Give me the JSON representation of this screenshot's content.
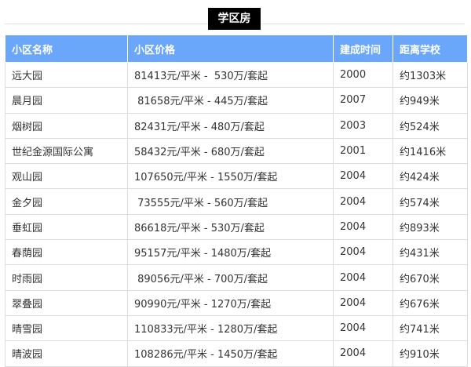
{
  "title": "学区房",
  "table": {
    "headers": [
      "小区名称",
      "小区价格",
      "建成时间",
      "距离学校"
    ],
    "rows": [
      [
        "远大园",
        "81413元/平米 -  530万/套起",
        "2000",
        "约1303米"
      ],
      [
        "晨月园",
        " 81658元/平米 - 445万/套起",
        "2007",
        "约949米"
      ],
      [
        "烟树园",
        "82431元/平米 - 480万/套起",
        "2003",
        "约524米"
      ],
      [
        "世纪金源国际公寓",
        "58432元/平米 - 680万/套起",
        "2001",
        "约1416米"
      ],
      [
        "观山园",
        "107650元/平米 - 1550万/套起",
        "2004",
        "约424米"
      ],
      [
        "金夕园",
        " 73555元/平米 - 560万/套起",
        "2004",
        "约574米"
      ],
      [
        "垂虹园",
        "86618元/平米 - 530万/套起",
        "2004",
        "约893米"
      ],
      [
        "春荫园",
        "95157元/平米 - 1480万/套起",
        "2004",
        "约431米"
      ],
      [
        "时雨园",
        " 89056元/平米 - 700万/套起",
        "2004",
        "约670米"
      ],
      [
        "翠叠园",
        "90990元/平米 - 1270万/套起",
        "2004",
        "约676米"
      ],
      [
        "晴雪园",
        "110833元/平米 - 1280万/套起",
        "2004",
        "约741米"
      ],
      [
        "晴波园",
        "108286元/平米 - 1450万/套起",
        "2004",
        "约910米"
      ]
    ]
  },
  "colors": {
    "header_bg": "#6aa7fa",
    "header_text": "#ffffff",
    "title_bg": "#000000",
    "border": "#dddddd"
  }
}
